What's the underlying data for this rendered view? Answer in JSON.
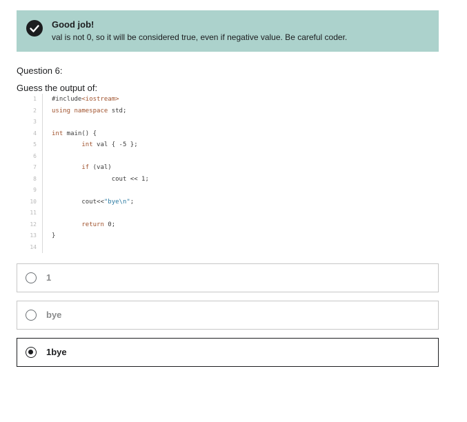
{
  "feedback": {
    "icon": "check-circle-icon",
    "title": "Good job!",
    "message": "val is not 0, so it will be considered true, even if negative value. Be careful coder.",
    "background": "#acd2cc"
  },
  "question": {
    "number_label": "Question 6:",
    "prompt": "Guess the output of:",
    "code_lines": [
      {
        "n": "1",
        "tokens": [
          {
            "t": "#include",
            "c": "plain"
          },
          {
            "t": "<iostream>",
            "c": "kw"
          }
        ]
      },
      {
        "n": "2",
        "tokens": [
          {
            "t": "using namespace",
            "c": "kw"
          },
          {
            "t": " std;",
            "c": "plain"
          }
        ]
      },
      {
        "n": "3",
        "tokens": []
      },
      {
        "n": "4",
        "tokens": [
          {
            "t": "int",
            "c": "kw"
          },
          {
            "t": " main() {",
            "c": "plain"
          }
        ]
      },
      {
        "n": "5",
        "tokens": [
          {
            "t": "        ",
            "c": "plain"
          },
          {
            "t": "int",
            "c": "kw"
          },
          {
            "t": " val { -5 };",
            "c": "plain"
          }
        ]
      },
      {
        "n": "6",
        "tokens": []
      },
      {
        "n": "7",
        "tokens": [
          {
            "t": "        ",
            "c": "plain"
          },
          {
            "t": "if",
            "c": "kw"
          },
          {
            "t": " (val)",
            "c": "plain"
          }
        ]
      },
      {
        "n": "8",
        "tokens": [
          {
            "t": "                cout << 1;",
            "c": "plain"
          }
        ]
      },
      {
        "n": "9",
        "tokens": []
      },
      {
        "n": "10",
        "tokens": [
          {
            "t": "        cout<<",
            "c": "plain"
          },
          {
            "t": "\"bye\\n\"",
            "c": "str"
          },
          {
            "t": ";",
            "c": "plain"
          }
        ]
      },
      {
        "n": "11",
        "tokens": []
      },
      {
        "n": "12",
        "tokens": [
          {
            "t": "        ",
            "c": "plain"
          },
          {
            "t": "return",
            "c": "kw"
          },
          {
            "t": " 0;",
            "c": "plain"
          }
        ]
      },
      {
        "n": "13",
        "tokens": [
          {
            "t": "}",
            "c": "plain"
          }
        ]
      },
      {
        "n": "14",
        "tokens": []
      }
    ]
  },
  "options": [
    {
      "label": "1",
      "selected": false
    },
    {
      "label": "bye",
      "selected": false
    },
    {
      "label": "1bye",
      "selected": true
    }
  ]
}
